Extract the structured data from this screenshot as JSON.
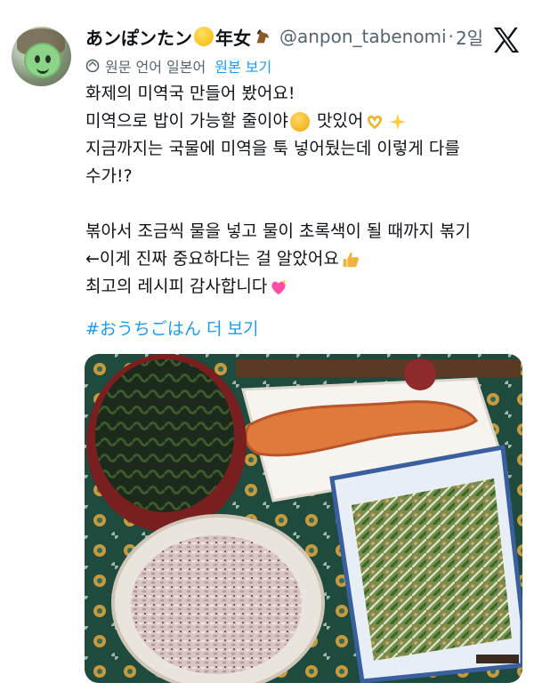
{
  "tweet": {
    "display_name": "あンぽンたン",
    "name_suffix": "年女",
    "handle": "@anpon_tabenomi",
    "separator": "·",
    "time": "2일",
    "translation": {
      "label": "원문 언어 일본어",
      "link": "원본 보기"
    },
    "lines": [
      "화제의 미역국 만들어 봤어요!",
      "미역으로 밥이 가능할 줄이야",
      "맛있어",
      "지금까지는 국물에 미역을 툭 넣어뒀는데 이렇게 다를",
      "수가!?",
      "볶아서 조금씩 물을 넣고 물이 초록색이 될 때까지 볶기",
      "←이게 진짜 중요하다는 걸 알았어요",
      "최고의 레시피 감사합니다"
    ],
    "hashtag": "#おうちごはん",
    "more_label": "더 보기"
  },
  "icons": [
    "avatar",
    "smiling-emoji-icon",
    "horse-emoji-icon",
    "x-logo-icon",
    "translate-icon",
    "surprised-emoji-icon",
    "heart-hands-emoji-icon",
    "sparkles-emoji-icon",
    "thumbs-up-emoji-icon",
    "sparkling-heart-emoji-icon"
  ],
  "colors": {
    "link": "#1d9bf0",
    "secondary": "#536471",
    "text": "#0f1419"
  }
}
